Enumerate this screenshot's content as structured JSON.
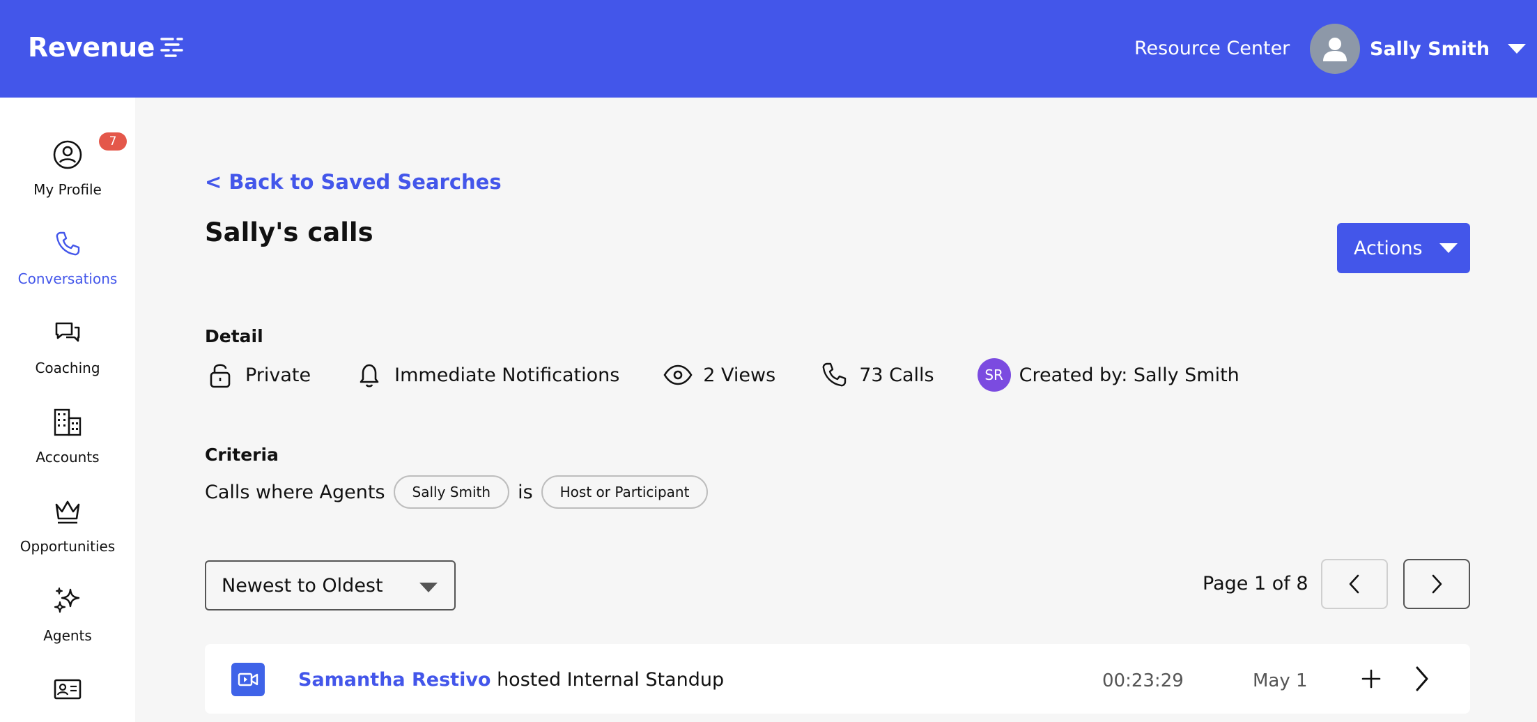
{
  "header": {
    "logo_text": "Revenue",
    "resource_center": "Resource Center",
    "user_name": "Sally Smith"
  },
  "sidebar": {
    "items": [
      {
        "label": "My Profile",
        "icon": "user-circle-icon",
        "badge": "7"
      },
      {
        "label": "Conversations",
        "icon": "phone-icon",
        "active": true
      },
      {
        "label": "Coaching",
        "icon": "chat-bubbles-icon"
      },
      {
        "label": "Accounts",
        "icon": "building-icon"
      },
      {
        "label": "Opportunities",
        "icon": "crown-icon"
      },
      {
        "label": "Agents",
        "icon": "sparkles-icon"
      },
      {
        "label": "",
        "icon": "id-card-icon"
      }
    ]
  },
  "main": {
    "back_link": "< Back to Saved Searches",
    "title": "Sally's calls",
    "actions_label": "Actions",
    "detail": {
      "label": "Detail",
      "privacy": "Private",
      "notifications": "Immediate Notifications",
      "views": "2 Views",
      "calls": "73 Calls",
      "creator_initials": "SR",
      "created_by": "Created by: Sally Smith"
    },
    "criteria": {
      "label": "Criteria",
      "prefix": "Calls where Agents",
      "agent_chip": "Sally Smith",
      "operator": "is",
      "role_chip": "Host or Participant"
    },
    "sort": {
      "selected": "Newest to Oldest"
    },
    "pagination": {
      "label": "Page 1 of 8"
    },
    "calls": [
      {
        "host": "Samantha Restivo",
        "title_rest": " hosted Internal Standup",
        "duration": "00:23:29",
        "date": "May 1"
      }
    ]
  },
  "colors": {
    "brand": "#4356ea",
    "badge": "#e4574a",
    "avatar_purple": "#7b4be0"
  }
}
